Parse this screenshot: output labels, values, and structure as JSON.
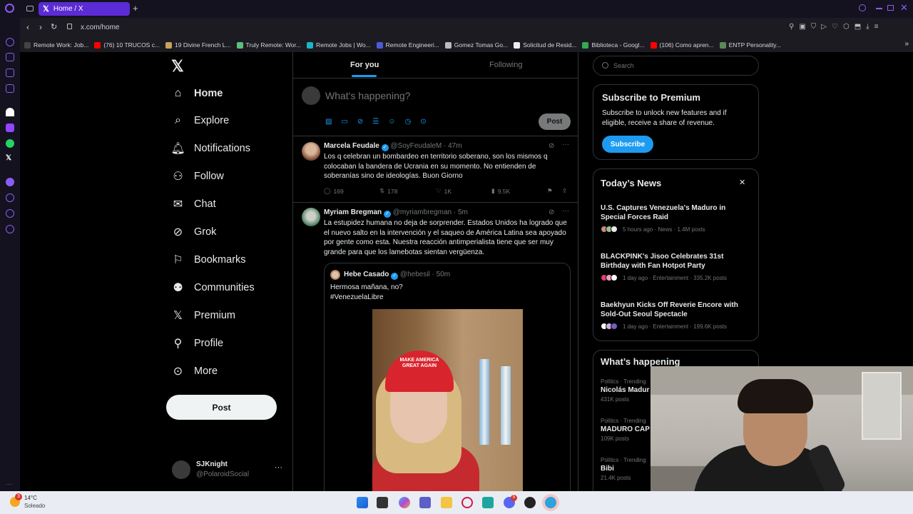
{
  "browser": {
    "tab_title": "Home / X",
    "url": "x.com/home",
    "bookmarks": [
      {
        "label": "Remote Work: Job...",
        "color": "#444"
      },
      {
        "label": "(76) 10 TRUCOS c...",
        "color": "#ff0000"
      },
      {
        "label": "19 Divine French L...",
        "color": "#c9a15a"
      },
      {
        "label": "Truly Remote: Wor...",
        "color": "#5bbf7a"
      },
      {
        "label": "Remote Jobs | Wo...",
        "color": "#19b5c8"
      },
      {
        "label": "Remote Engineeri...",
        "color": "#4b5bd6"
      },
      {
        "label": "Gomez Tomas Go...",
        "color": "#bbbbbb"
      },
      {
        "label": "Solicitud de Resid...",
        "color": "#eeeeee"
      },
      {
        "label": "Biblioteca - Googl...",
        "color": "#34a853"
      },
      {
        "label": "(106) Como apren...",
        "color": "#ff0000"
      },
      {
        "label": "ENTP Personality...",
        "color": "#5a8a5a"
      }
    ]
  },
  "nav": {
    "items": [
      {
        "label": "Home",
        "icon": "home-icon"
      },
      {
        "label": "Explore",
        "icon": "search-icon"
      },
      {
        "label": "Notifications",
        "icon": "bell-icon"
      },
      {
        "label": "Follow",
        "icon": "person-add-icon"
      },
      {
        "label": "Chat",
        "icon": "mail-icon"
      },
      {
        "label": "Grok",
        "icon": "grok-icon"
      },
      {
        "label": "Bookmarks",
        "icon": "bookmark-icon"
      },
      {
        "label": "Communities",
        "icon": "communities-icon"
      },
      {
        "label": "Premium",
        "icon": "x-logo-icon"
      },
      {
        "label": "Profile",
        "icon": "person-icon"
      },
      {
        "label": "More",
        "icon": "more-circle-icon"
      }
    ],
    "post_label": "Post",
    "account": {
      "name": "SJKnight",
      "handle": "@PolaroidSocial"
    }
  },
  "timeline": {
    "tabs": [
      "For you",
      "Following"
    ],
    "composer_placeholder": "What's happening?",
    "composer_post_label": "Post",
    "tweets": [
      {
        "name": "Marcela Feudale",
        "handle": "@SoyFeudaleM",
        "time": "· 47m",
        "text": "Los q celebran un bombardeo en territorio soberano, son los mismos q colocaban la bandera de Ucrania en su momento. No entienden de soberanías sino de ideologías. Buon Giorno",
        "replies": "169",
        "reposts": "178",
        "likes": "1K",
        "views": "9.5K"
      },
      {
        "name": "Myriam Bregman",
        "handle": "@myriambregman",
        "time": "· 5m",
        "text": "La estupidez humana no deja de sorprender. Estados Unidos ha logrado que el nuevo salto en la intervención y el saqueo de América Latina sea apoyado por gente como esta.  Nuestra reacción antimperialista tiene que ser muy grande para que los lamebotas sientan vergüenza.",
        "quote": {
          "name": "Hebe Casado",
          "handle": "@hebesil",
          "time": "· 50m",
          "text_line1": "Hermosa mañana, no?",
          "text_line2": "#VenezuelaLibre",
          "cap_text": "MAKE AMERICA GREAT AGAIN"
        }
      }
    ]
  },
  "sidebar": {
    "search_placeholder": "Search",
    "premium": {
      "title": "Subscribe to Premium",
      "text": "Subscribe to unlock new features and if eligible, receive a share of revenue.",
      "button": "Subscribe"
    },
    "news": {
      "title": "Today’s News",
      "items": [
        {
          "title": "U.S. Captures Venezuela's Maduro in Special Forces Raid",
          "meta": "5 hours ago · News · 1.4M posts"
        },
        {
          "title": "BLACKPINK's Jisoo Celebrates 31st Birthday with Fan Hotpot Party",
          "meta": "1 day ago · Entertainment · 335.2K posts"
        },
        {
          "title": "Baekhyun Kicks Off Reverie Encore with Sold-Out Seoul Spectacle",
          "meta": "1 day ago · Entertainment · 199.6K posts"
        }
      ]
    },
    "happening": {
      "title": "What’s happening",
      "trends": [
        {
          "category": "Politics · Trending",
          "name": "Nicolás Madur",
          "count": "431K posts"
        },
        {
          "category": "Politics · Trending",
          "name": "MADURO CAP",
          "count": "109K posts"
        },
        {
          "category": "Politics · Trending",
          "name": "Bibi",
          "count": "21.4K posts"
        }
      ]
    }
  },
  "taskbar": {
    "weather_temp": "14°C",
    "weather_desc": "Soleado",
    "weather_badge": "3",
    "discord_badge": "5"
  }
}
